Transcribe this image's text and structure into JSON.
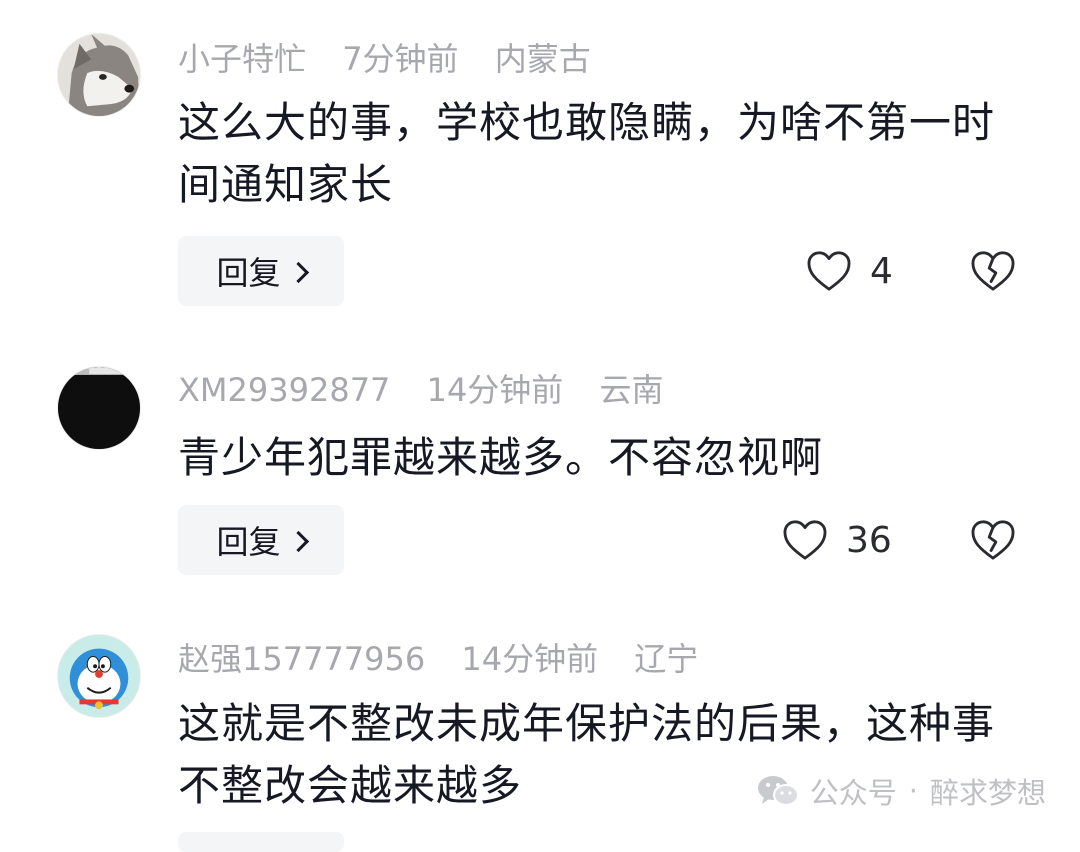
{
  "comments": [
    {
      "username": "小子特忙",
      "time": "7分钟前",
      "location": "内蒙古",
      "text": "这么大的事，学校也敢隐瞒，为啥不第一时间通知家长",
      "reply_label": "回复",
      "likes": "4",
      "avatar_icon": "husky-dog-avatar"
    },
    {
      "username": "XM29392877",
      "time": "14分钟前",
      "location": "云南",
      "text": "青少年犯罪越来越多。不容忽视啊",
      "reply_label": "回复",
      "likes": "36",
      "avatar_icon": "dark-screen-avatar"
    },
    {
      "username": "赵强157777956",
      "time": "14分钟前",
      "location": "辽宁",
      "text": "这就是不整改未成年保护法的后果，这种事不整改会越来越多",
      "avatar_icon": "doraemon-avatar"
    }
  ],
  "watermark": {
    "source": "公众号",
    "separator": "·",
    "name": "醉求梦想",
    "icon": "wechat-icon"
  },
  "colors": {
    "meta": "#a7a8ad",
    "text": "#161823",
    "button_bg": "#f4f5f7",
    "watermark": "#bfc0c4"
  }
}
